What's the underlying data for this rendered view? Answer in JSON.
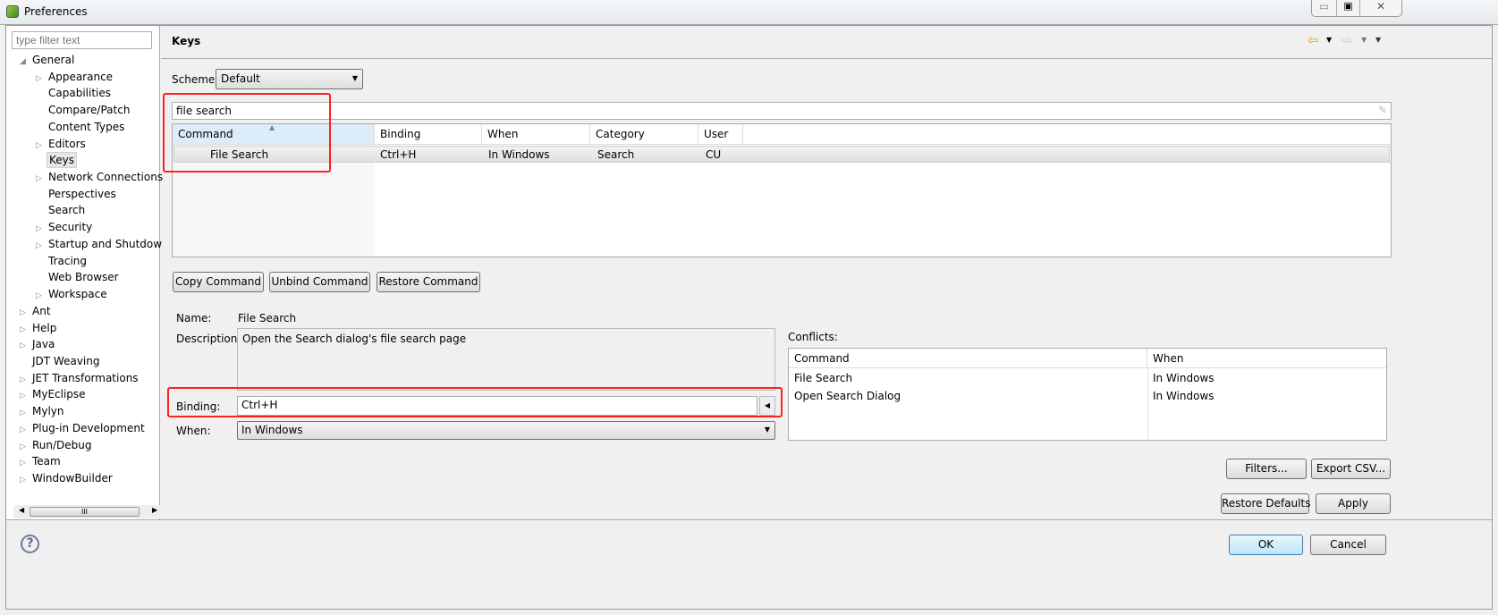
{
  "window": {
    "title": "Preferences",
    "icon": "eclipse-leaf-icon"
  },
  "sidebar": {
    "filter_placeholder": "type filter text",
    "items": [
      {
        "label": "General",
        "level": 0,
        "expanded": true
      },
      {
        "label": "Appearance",
        "level": 1,
        "expandable": true
      },
      {
        "label": "Capabilities",
        "level": 1
      },
      {
        "label": "Compare/Patch",
        "level": 1
      },
      {
        "label": "Content Types",
        "level": 1
      },
      {
        "label": "Editors",
        "level": 1,
        "expandable": true
      },
      {
        "label": "Keys",
        "level": 1,
        "selected": true
      },
      {
        "label": "Network Connections",
        "level": 1,
        "expandable": true
      },
      {
        "label": "Perspectives",
        "level": 1
      },
      {
        "label": "Search",
        "level": 1
      },
      {
        "label": "Security",
        "level": 1,
        "expandable": true
      },
      {
        "label": "Startup and Shutdow",
        "level": 1,
        "expandable": true
      },
      {
        "label": "Tracing",
        "level": 1
      },
      {
        "label": "Web Browser",
        "level": 1
      },
      {
        "label": "Workspace",
        "level": 1,
        "expandable": true
      },
      {
        "label": "Ant",
        "level": 0,
        "expandable": true
      },
      {
        "label": "Help",
        "level": 0,
        "expandable": true
      },
      {
        "label": "Java",
        "level": 0,
        "expandable": true
      },
      {
        "label": "JDT Weaving",
        "level": 0
      },
      {
        "label": "JET Transformations",
        "level": 0,
        "expandable": true
      },
      {
        "label": "MyEclipse",
        "level": 0,
        "expandable": true
      },
      {
        "label": "Mylyn",
        "level": 0,
        "expandable": true
      },
      {
        "label": "Plug-in Development",
        "level": 0,
        "expandable": true
      },
      {
        "label": "Run/Debug",
        "level": 0,
        "expandable": true
      },
      {
        "label": "Team",
        "level": 0,
        "expandable": true
      },
      {
        "label": "WindowBuilder",
        "level": 0,
        "expandable": true
      }
    ],
    "scroll_thumb": "III"
  },
  "page": {
    "title": "Keys",
    "scheme_label": "Scheme:",
    "scheme_value": "Default",
    "filter_value": "file search",
    "table": {
      "columns": [
        "Command",
        "Binding",
        "When",
        "Category",
        "User"
      ],
      "rows": [
        [
          "File Search",
          "Ctrl+H",
          "In Windows",
          "Search",
          "CU"
        ]
      ]
    },
    "buttons": {
      "copy": "Copy Command",
      "unbind": "Unbind Command",
      "restore": "Restore Command"
    },
    "name_label": "Name:",
    "name_value": "File Search",
    "description_label": "Description:",
    "description_value": "Open the Search dialog's file search page",
    "binding_label": "Binding:",
    "binding_value": "Ctrl+H",
    "when_label": "When:",
    "when_value": "In Windows",
    "conflicts": {
      "label": "Conflicts:",
      "columns": [
        "Command",
        "When"
      ],
      "rows": [
        [
          "File Search",
          "In Windows"
        ],
        [
          "Open Search Dialog",
          "In Windows"
        ]
      ]
    },
    "filters_button": "Filters...",
    "export_button": "Export CSV...",
    "restore_defaults_button": "Restore Defaults",
    "apply_button": "Apply"
  },
  "footer": {
    "ok": "OK",
    "cancel": "Cancel"
  },
  "colors": {
    "highlight_box": "#ff2020",
    "header_selected": "#dcecf8",
    "ok_border": "#3c7fb1"
  }
}
